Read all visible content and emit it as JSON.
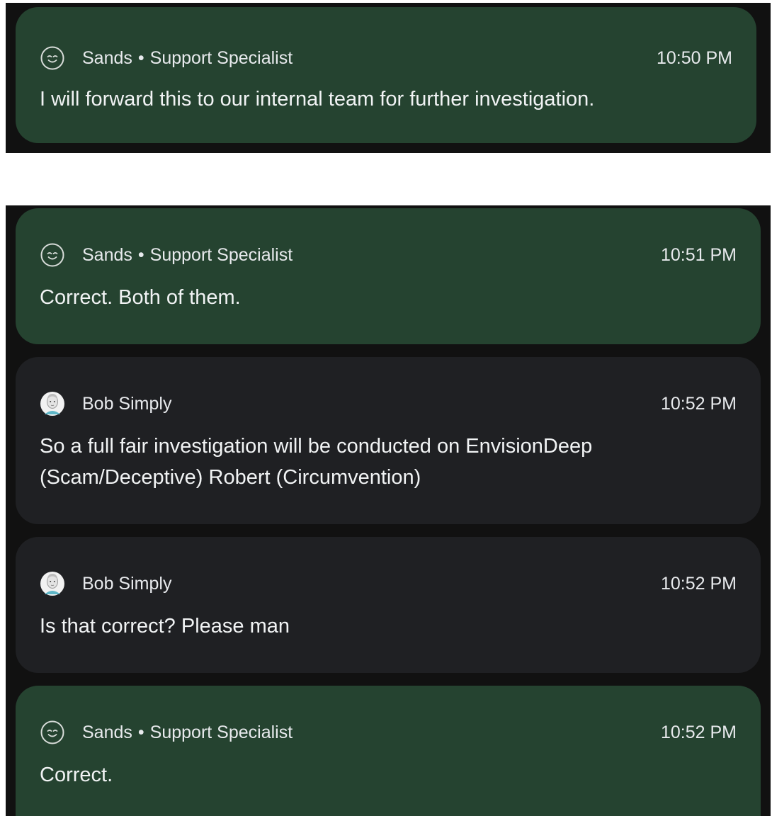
{
  "messages": [
    {
      "sender": "Sands",
      "separator": "•",
      "role": "Support Specialist",
      "time": "10:50 PM",
      "text": "I will forward this to our internal team for further investigation.",
      "avatar": "smiley-icon"
    },
    {
      "sender": "Sands",
      "separator": "•",
      "role": "Support Specialist",
      "time": "10:51 PM",
      "text": "Correct. Both of them.",
      "avatar": "smiley-icon"
    },
    {
      "sender": "Bob Simply",
      "time": "10:52 PM",
      "text": "So a full fair investigation will be conducted on EnvisionDeep (Scam/Deceptive) Robert (Circumvention)",
      "avatar": "user-avatar"
    },
    {
      "sender": "Bob Simply",
      "time": "10:52 PM",
      "text": "Is that correct? Please man",
      "avatar": "user-avatar"
    },
    {
      "sender": "Sands",
      "separator": "•",
      "role": "Support Specialist",
      "time": "10:52 PM",
      "text": "Correct.",
      "avatar": "smiley-icon"
    }
  ],
  "colors": {
    "agent_bubble": "#254330",
    "user_bubble": "#1f2023",
    "panel_background": "#111111",
    "page_background": "#ffffff"
  }
}
